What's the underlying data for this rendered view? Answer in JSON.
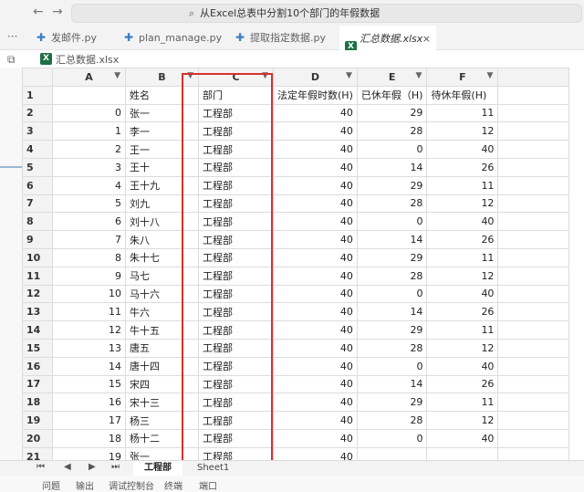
{
  "titlebar": {
    "back": "←",
    "forward": "→",
    "search_glyph": "⌕",
    "command_text": "从Excel总表中分割10个部门的年假数据"
  },
  "left": {
    "more": "···"
  },
  "tabs": [
    {
      "label": "发邮件.py",
      "icon": "python-icon",
      "close": ""
    },
    {
      "label": "plan_manage.py",
      "icon": "python-icon",
      "close": ""
    },
    {
      "label": "提取指定数据.py",
      "icon": "python-icon",
      "close": ""
    },
    {
      "label": "汇总数据.xlsx",
      "icon": "excel-icon",
      "close": "×"
    }
  ],
  "breadcrumb": {
    "label": "汇总数据.xlsx",
    "xl": "X"
  },
  "sheet": {
    "columns": [
      "A",
      "B",
      "C",
      "D",
      "E",
      "F"
    ],
    "rows": [
      {
        "n": "1",
        "a": "",
        "b": "姓名",
        "c": "部门",
        "d": "法定年假时数(H)",
        "e": "已休年假（H)",
        "f": "待休年假(H)",
        "header": true
      },
      {
        "n": "2",
        "a": "0",
        "b": "张一",
        "c": "工程部",
        "d": "40",
        "e": "29",
        "f": "11"
      },
      {
        "n": "3",
        "a": "1",
        "b": "李一",
        "c": "工程部",
        "d": "40",
        "e": "28",
        "f": "12"
      },
      {
        "n": "4",
        "a": "2",
        "b": "王一",
        "c": "工程部",
        "d": "40",
        "e": "0",
        "f": "40"
      },
      {
        "n": "5",
        "a": "3",
        "b": "王十",
        "c": "工程部",
        "d": "40",
        "e": "14",
        "f": "26"
      },
      {
        "n": "6",
        "a": "4",
        "b": "王十九",
        "c": "工程部",
        "d": "40",
        "e": "29",
        "f": "11"
      },
      {
        "n": "7",
        "a": "5",
        "b": "刘九",
        "c": "工程部",
        "d": "40",
        "e": "28",
        "f": "12"
      },
      {
        "n": "8",
        "a": "6",
        "b": "刘十八",
        "c": "工程部",
        "d": "40",
        "e": "0",
        "f": "40"
      },
      {
        "n": "9",
        "a": "7",
        "b": "朱八",
        "c": "工程部",
        "d": "40",
        "e": "14",
        "f": "26"
      },
      {
        "n": "10",
        "a": "8",
        "b": "朱十七",
        "c": "工程部",
        "d": "40",
        "e": "29",
        "f": "11"
      },
      {
        "n": "11",
        "a": "9",
        "b": "马七",
        "c": "工程部",
        "d": "40",
        "e": "28",
        "f": "12"
      },
      {
        "n": "12",
        "a": "10",
        "b": "马十六",
        "c": "工程部",
        "d": "40",
        "e": "0",
        "f": "40"
      },
      {
        "n": "13",
        "a": "11",
        "b": "牛六",
        "c": "工程部",
        "d": "40",
        "e": "14",
        "f": "26"
      },
      {
        "n": "14",
        "a": "12",
        "b": "牛十五",
        "c": "工程部",
        "d": "40",
        "e": "29",
        "f": "11"
      },
      {
        "n": "15",
        "a": "13",
        "b": "唐五",
        "c": "工程部",
        "d": "40",
        "e": "28",
        "f": "12"
      },
      {
        "n": "16",
        "a": "14",
        "b": "唐十四",
        "c": "工程部",
        "d": "40",
        "e": "0",
        "f": "40"
      },
      {
        "n": "17",
        "a": "15",
        "b": "宋四",
        "c": "工程部",
        "d": "40",
        "e": "14",
        "f": "26"
      },
      {
        "n": "18",
        "a": "16",
        "b": "宋十三",
        "c": "工程部",
        "d": "40",
        "e": "29",
        "f": "11"
      },
      {
        "n": "19",
        "a": "17",
        "b": "杨三",
        "c": "工程部",
        "d": "40",
        "e": "28",
        "f": "12"
      },
      {
        "n": "20",
        "a": "18",
        "b": "杨十二",
        "c": "工程部",
        "d": "40",
        "e": "0",
        "f": "40"
      },
      {
        "n": "21",
        "a": "19",
        "b": "张一",
        "c": "工程部",
        "d": "40",
        "e": "",
        "f": ""
      }
    ]
  },
  "sheet_tabs": [
    "工程部",
    "Sheet1"
  ],
  "sheet_nav": [
    "⏮",
    "◀",
    "▶",
    "⏭"
  ],
  "panel_tabs": [
    "问题",
    "输出",
    "调试控制台",
    "终端",
    "端口"
  ],
  "colors": {
    "highlight": "#d9302c",
    "excel": "#1d7044"
  }
}
